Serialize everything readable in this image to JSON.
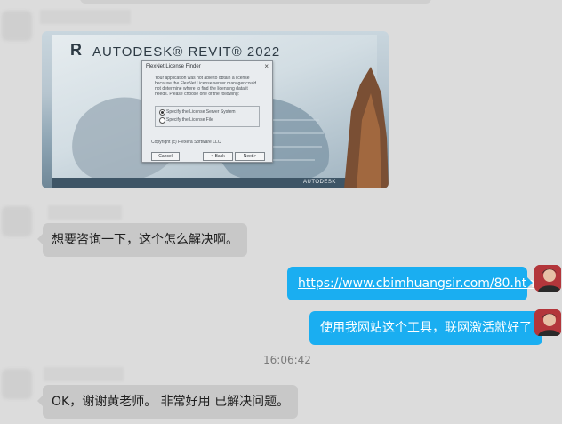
{
  "image_post": {
    "revit_logo_letter": "R",
    "revit_title": "AUTODESK® REVIT® 2022",
    "dialog": {
      "title": "FlexNet License Finder",
      "close": "×",
      "message": "Your application was not able to obtain a license because the FlexNet License server manager could not determine where to find the licensing data it needs. Please choose one of the following:",
      "option1": "Specify the License Server System",
      "option2": "Specify the License File",
      "copyright": "Copyright (c) Flexera Software LLC",
      "btn_cancel": "Cancel",
      "btn_back": "< Back",
      "btn_next": "Next >"
    },
    "brand_footer": "AUTODESK"
  },
  "messages": {
    "question": "想要咨询一下，这个怎么解决啊。",
    "link": "https://www.cbimhuangsir.com/80.html",
    "reply": "使用我网站这个工具，联网激活就好了",
    "timestamp": "16:06:42",
    "thanks": "OK，谢谢黄老师。 非常好用 已解决问题。"
  },
  "colors": {
    "background": "#dcdcdc",
    "bubble_left": "#c8c8c8",
    "bubble_right": "#1aaef1"
  }
}
